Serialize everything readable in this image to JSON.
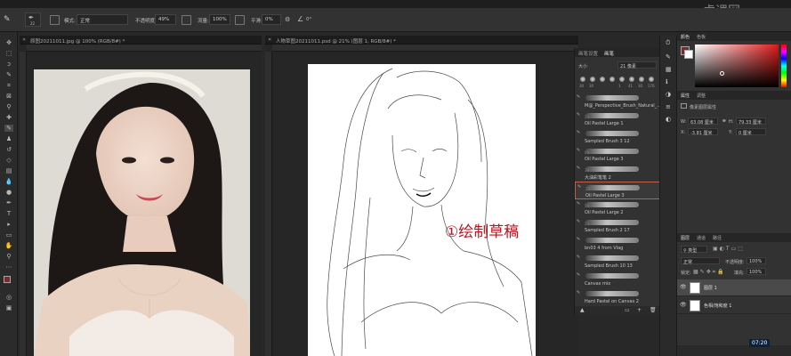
{
  "options_bar": {
    "mode_label": "模式:",
    "mode_value": "正常",
    "opacity_label": "不透明度:",
    "opacity_value": "49%",
    "flow_label": "流量:",
    "flow_value": "100%",
    "smooth_label": "平滑:",
    "smooth_value": "0%",
    "angle_value": "0°",
    "brush_size": "22"
  },
  "watermark": "虎课网",
  "doc_left": {
    "tab_title": "原图20211011.jpg @ 100% (RGB/8#) *"
  },
  "doc_right": {
    "tab_title": "人物草图20211011.psd @ 21% (图层 1, RGB/8#) *",
    "annotation": "①绘制草稿"
  },
  "brush_panel": {
    "tabs": [
      "画笔设置",
      "画笔"
    ],
    "size_label": "大小",
    "size_value": "21 像素",
    "preset_nums": [
      "30",
      "30",
      "",
      "",
      "1",
      "41",
      "30",
      "176"
    ],
    "brushes": [
      {
        "num": "",
        "name": "M@_Perspective_Brush_Natural_..."
      },
      {
        "num": "23",
        "name": "Oil Pastel Large 1"
      },
      {
        "num": "",
        "name": "Sampled Brush 3 12"
      },
      {
        "num": "60",
        "name": "Oil Pastel Large 3"
      },
      {
        "num": "39",
        "name": "大油彩笔笔 2"
      },
      {
        "num": "23",
        "name": "Oil Pastel Large 3"
      },
      {
        "num": "50",
        "name": "Oil Pastel Large 2"
      },
      {
        "num": "23",
        "name": "Sampled Brush 2 17"
      },
      {
        "num": "",
        "name": "bn03 4 from Vlag"
      },
      {
        "num": "",
        "name": "Sampled Brush 10 13"
      },
      {
        "num": "",
        "name": "Canvas mix"
      },
      {
        "num": "",
        "name": "Hard Pastel on Canvas 2"
      }
    ],
    "selected_index": 5
  },
  "color_panel": {
    "tabs": [
      "颜色",
      "色板"
    ],
    "fg_color": "#7a2a2a",
    "hue_color": "#e01a1a"
  },
  "properties_panel": {
    "tabs": [
      "属性",
      "调整"
    ],
    "layer_type": "像素图层属性",
    "w_label": "W:",
    "w_value": "63.08 厘米",
    "h_label": "H:",
    "h_value": "79.33 厘米",
    "x_label": "X:",
    "x_value": "-3.81 厘米",
    "y_label": "Y:",
    "y_value": "0 厘米"
  },
  "layers_panel": {
    "tabs": [
      "图层",
      "通道",
      "路径"
    ],
    "kind_label": "类型",
    "blend_mode": "正常",
    "opacity_label": "不透明度:",
    "opacity_value": "100%",
    "lock_label": "锁定:",
    "fill_label": "填充:",
    "fill_value": "100%",
    "layers": [
      {
        "name": "图层 1",
        "selected": true
      },
      {
        "name": "色相/饱和度 1",
        "selected": false
      }
    ]
  },
  "taskbar_time": "07:20",
  "colors": {
    "annotation": "#c1121f",
    "selected_brush_border": "#c0624a"
  }
}
